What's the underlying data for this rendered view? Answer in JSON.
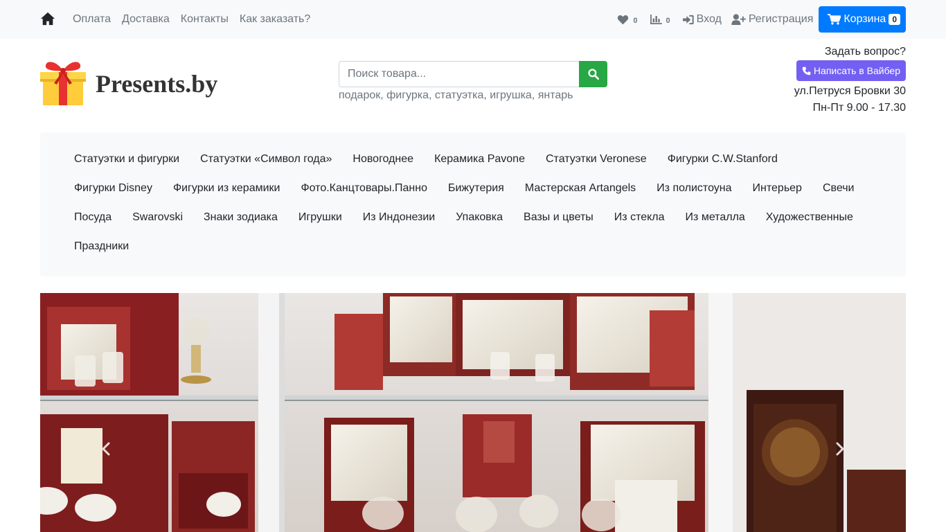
{
  "topbar": {
    "links": [
      "Оплата",
      "Доставка",
      "Контакты",
      "Как заказать?"
    ],
    "wishlist_count": "0",
    "compare_count": "0",
    "login": "Вход",
    "register": "Регистрация",
    "cart_label": "Корзина",
    "cart_count": "0"
  },
  "header": {
    "brand": "Presents.by",
    "search_placeholder": "Поиск товара...",
    "search_hints": "подарок, фигурка, статуэтка, игрушка, янтарь",
    "ask_question": "Задать вопрос?",
    "viber_button": "Написать в Вайбер",
    "address": "ул.Петруся Бровки 30",
    "hours": "Пн-Пт 9.00 - 17.30"
  },
  "categories": [
    [
      "Статуэтки и фигурки",
      "Статуэтки «Символ года»",
      "Новогоднее",
      "Керамика Pavone",
      "Статуэтки Veronese",
      "Фигурки C.W.Stanford"
    ],
    [
      "Фигурки Disney",
      "Фигурки из керамики",
      "Фото.Канцтовары.Панно",
      "Бижутерия",
      "Мастерская Artangels",
      "Из полистоуна",
      "Интерьер",
      "Свечи"
    ],
    [
      "Посуда",
      "Swarovski",
      "Знаки зодиака",
      "Игрушки",
      "Из Индонезии",
      "Упаковка",
      "Вазы и цветы",
      "Из стекла",
      "Из металла",
      "Художественные"
    ],
    [
      "Праздники"
    ]
  ],
  "colors": {
    "primary": "#007bff",
    "success": "#28a745",
    "viber": "#7360f2",
    "topbar_bg": "#f8f9fa",
    "muted": "#6c757d"
  },
  "icons": {
    "home": "home-icon",
    "wishlist": "heart-icon",
    "compare": "bar-chart-icon",
    "login": "sign-in-icon",
    "register": "user-plus-icon",
    "cart": "cart-icon",
    "search": "search-icon",
    "phone": "phone-icon",
    "prev": "chevron-left-icon",
    "next": "chevron-right-icon"
  }
}
